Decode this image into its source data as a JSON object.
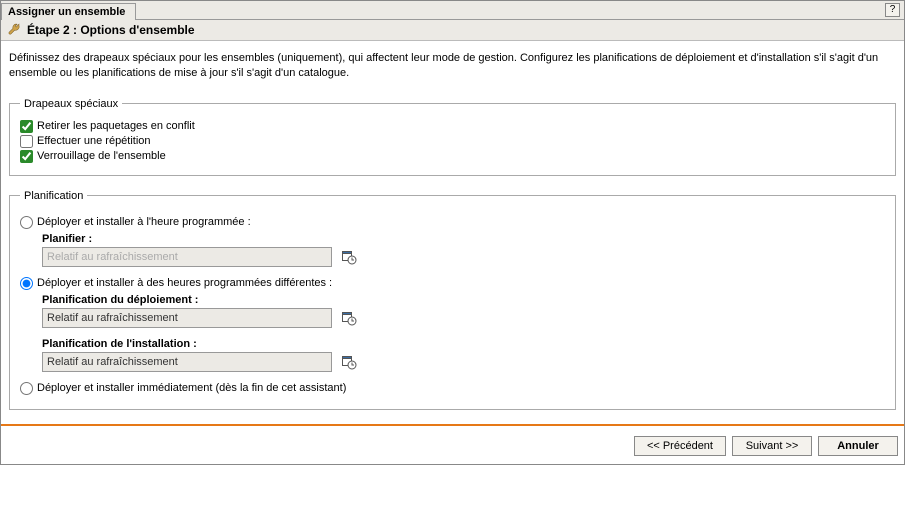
{
  "header": {
    "tab_title": "Assigner un ensemble",
    "help_label": "?"
  },
  "step": {
    "title": "Étape 2 : Options d'ensemble"
  },
  "description": "Définissez des drapeaux spéciaux pour les ensembles (uniquement), qui affectent leur mode de gestion. Configurez les planifications de déploiement et d'installation s'il s'agit d'un ensemble ou les planifications de mise à jour s'il s'agit d'un catalogue.",
  "flags": {
    "legend": "Drapeaux spéciaux",
    "items": [
      {
        "label": "Retirer les paquetages en conflit",
        "checked": true
      },
      {
        "label": "Effectuer une répétition",
        "checked": false
      },
      {
        "label": "Verrouillage de l'ensemble",
        "checked": true
      }
    ]
  },
  "schedule": {
    "legend": "Planification",
    "options": [
      {
        "label": "Déployer et installer à l'heure programmée :",
        "selected": false,
        "fields": [
          {
            "label": "Planifier :",
            "value": "Relatif au rafraîchissement",
            "disabled": true
          }
        ]
      },
      {
        "label": "Déployer et installer à des heures programmées différentes :",
        "selected": true,
        "fields": [
          {
            "label": "Planification du déploiement :",
            "value": "Relatif au rafraîchissement",
            "disabled": false
          },
          {
            "label": "Planification de l'installation :",
            "value": "Relatif au rafraîchissement",
            "disabled": false
          }
        ]
      },
      {
        "label": "Déployer et installer immédiatement (dès la fin de cet assistant)",
        "selected": false,
        "fields": []
      }
    ]
  },
  "buttons": {
    "prev": "<< Précédent",
    "next": "Suivant >>",
    "cancel": "Annuler"
  }
}
